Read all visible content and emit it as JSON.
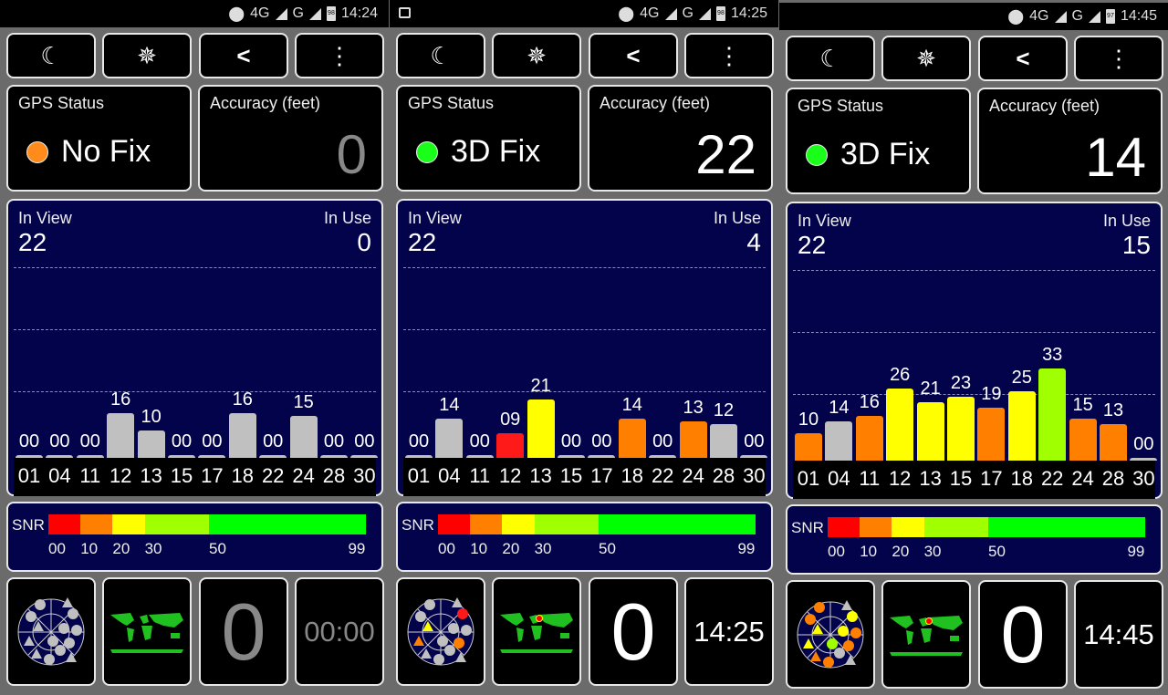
{
  "toolbar": {
    "icons": [
      "moon-icon",
      "compass-star-icon",
      "share-icon",
      "more-vert-icon"
    ],
    "glyphs": [
      "☾",
      "✵",
      "<",
      "⋮"
    ]
  },
  "labels": {
    "gps_status": "GPS Status",
    "accuracy": "Accuracy (feet)",
    "in_view": "In View",
    "in_use": "In Use",
    "snr": "SNR"
  },
  "snr_scale": {
    "ticks": [
      "00",
      "10",
      "20",
      "30",
      "50",
      "99"
    ],
    "segments": [
      {
        "from": 0,
        "to": 10,
        "color": "#ff0000"
      },
      {
        "from": 10,
        "to": 20,
        "color": "#ff8000"
      },
      {
        "from": 20,
        "to": 30,
        "color": "#ffff00"
      },
      {
        "from": 30,
        "to": 50,
        "color": "#a0ff00"
      },
      {
        "from": 50,
        "to": 99,
        "color": "#00ff00"
      }
    ]
  },
  "colors": {
    "grey": "#c0c0c0",
    "red": "#ff1a1a",
    "orange": "#ff8000",
    "yellow": "#ffff00",
    "lime": "#a0ff00"
  },
  "screens": [
    {
      "status_bar": {
        "icons": [
          "location-icon",
          "signal-icon",
          "battery-icon"
        ],
        "network": "4G",
        "network2": "G",
        "battery": "98",
        "time": "14:24",
        "image_icon": false
      },
      "gps_status": "No Fix",
      "status_color": "#ff8c1a",
      "accuracy": "0",
      "accuracy_dim": true,
      "in_view": "22",
      "in_use": "0",
      "chart_data": {
        "type": "bar",
        "categories": [
          "01",
          "04",
          "11",
          "12",
          "13",
          "15",
          "17",
          "18",
          "22",
          "24",
          "28",
          "30"
        ],
        "values": [
          0,
          0,
          0,
          16,
          10,
          0,
          0,
          16,
          0,
          15,
          0,
          0
        ],
        "labels": [
          "00",
          "00",
          "00",
          "16",
          "10",
          "00",
          "00",
          "16",
          "00",
          "15",
          "00",
          "00"
        ],
        "colors": [
          "grey",
          "grey",
          "grey",
          "grey",
          "grey",
          "grey",
          "grey",
          "grey",
          "grey",
          "grey",
          "grey",
          "grey"
        ]
      },
      "satellites_count": "0",
      "count_dim": true,
      "clock": "00:00",
      "clock_dim": true
    },
    {
      "status_bar": {
        "icons": [
          "location-icon",
          "signal-icon",
          "battery-icon"
        ],
        "network": "4G",
        "network2": "G",
        "battery": "98",
        "time": "14:25",
        "image_icon": true
      },
      "gps_status": "3D Fix",
      "status_color": "#1aff1a",
      "accuracy": "22",
      "accuracy_dim": false,
      "in_view": "22",
      "in_use": "4",
      "chart_data": {
        "type": "bar",
        "categories": [
          "01",
          "04",
          "11",
          "12",
          "13",
          "15",
          "17",
          "18",
          "22",
          "24",
          "28",
          "30"
        ],
        "values": [
          0,
          14,
          0,
          9,
          21,
          0,
          0,
          14,
          0,
          13,
          12,
          0
        ],
        "labels": [
          "00",
          "14",
          "00",
          "09",
          "21",
          "00",
          "00",
          "14",
          "00",
          "13",
          "12",
          "00"
        ],
        "colors": [
          "grey",
          "grey",
          "grey",
          "red",
          "yellow",
          "grey",
          "grey",
          "orange",
          "grey",
          "orange",
          "grey",
          "grey"
        ]
      },
      "satellites_count": "0",
      "count_dim": false,
      "clock": "14:25",
      "clock_dim": false
    },
    {
      "status_bar": {
        "icons": [
          "location-icon",
          "signal-icon",
          "battery-icon"
        ],
        "network": "4G",
        "network2": "G",
        "battery": "97",
        "time": "14:45",
        "image_icon": false
      },
      "gps_status": "3D Fix",
      "status_color": "#1aff1a",
      "accuracy": "14",
      "accuracy_dim": false,
      "in_view": "22",
      "in_use": "15",
      "chart_data": {
        "type": "bar",
        "categories": [
          "01",
          "04",
          "11",
          "12",
          "13",
          "15",
          "17",
          "18",
          "22",
          "24",
          "28",
          "30"
        ],
        "values": [
          10,
          14,
          16,
          26,
          21,
          23,
          19,
          25,
          33,
          15,
          13,
          0
        ],
        "labels": [
          "10",
          "14",
          "16",
          "26",
          "21",
          "23",
          "19",
          "25",
          "33",
          "15",
          "13",
          "00"
        ],
        "colors": [
          "orange",
          "grey",
          "orange",
          "yellow",
          "yellow",
          "yellow",
          "orange",
          "yellow",
          "lime",
          "orange",
          "orange",
          "grey"
        ]
      },
      "satellites_count": "0",
      "count_dim": false,
      "clock": "14:45",
      "clock_dim": false
    }
  ]
}
